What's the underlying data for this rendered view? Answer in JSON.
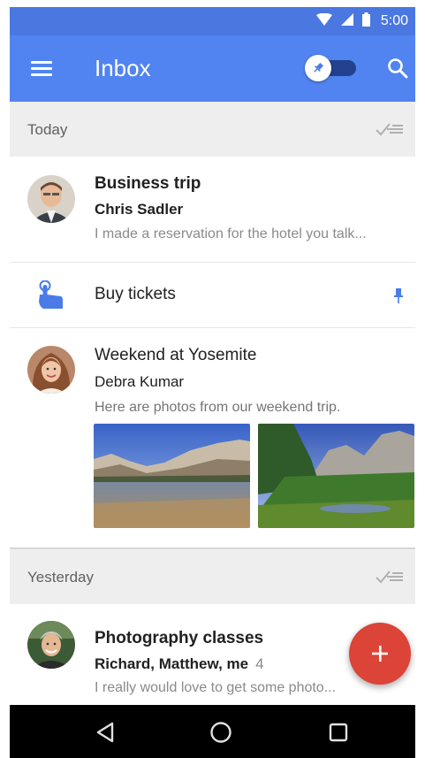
{
  "status_bar": {
    "time": "5:00"
  },
  "app_bar": {
    "title": "Inbox",
    "pin_toggle_on": false
  },
  "sections": {
    "today": {
      "label": "Today"
    },
    "yesterday": {
      "label": "Yesterday"
    }
  },
  "items": {
    "business_trip": {
      "title": "Business trip",
      "sender": "Chris Sadler",
      "snippet": "I made a reservation for the hotel you talk..."
    },
    "buy_tickets": {
      "title": "Buy tickets"
    },
    "yosemite": {
      "title": "Weekend at Yosemite",
      "sender": "Debra Kumar",
      "snippet": "Here are photos from our weekend trip."
    },
    "photography": {
      "title": "Photography classes",
      "sender": "Richard, Matthew, me",
      "count": "4",
      "snippet": "I really would love to get some photo..."
    }
  },
  "icons": {
    "menu": "menu-icon",
    "search": "search-icon",
    "pin": "pin-icon",
    "sweep": "sweep-icon",
    "reminder": "reminder-hand-icon",
    "compose": "plus-icon",
    "back": "back-icon",
    "home": "home-icon",
    "recents": "recents-icon"
  },
  "colors": {
    "status_bar": "#4a77e0",
    "app_bar": "#5184f0",
    "fab": "#db4437",
    "reminder": "#4a7ce8"
  }
}
